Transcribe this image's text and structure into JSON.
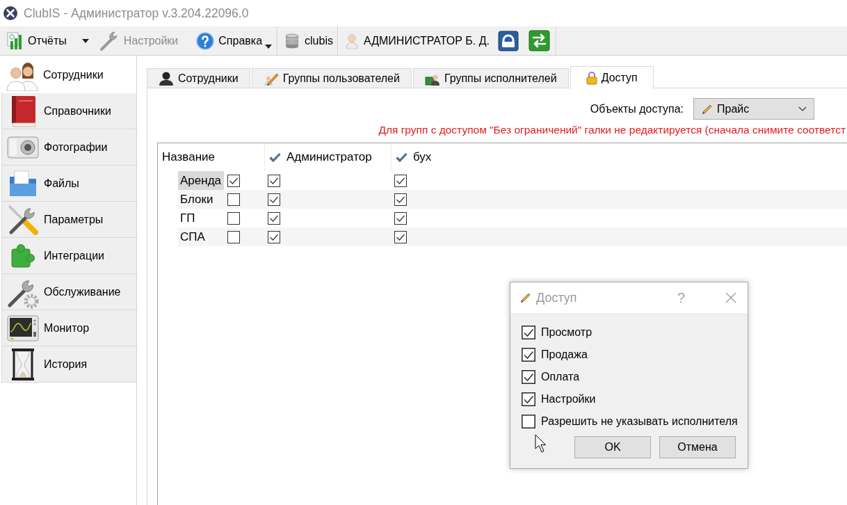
{
  "window": {
    "title": "ClubIS - Администратор v.3.204.22096.0"
  },
  "toolbar": {
    "groups": [
      {
        "items": [
          {
            "kind": "split",
            "label": "Отчёты",
            "disabled": false
          },
          {
            "kind": "button",
            "label": "Настройки",
            "disabled": true
          },
          {
            "kind": "menu",
            "label": "Справка",
            "disabled": false
          }
        ]
      },
      {
        "items": [
          {
            "kind": "label",
            "label": "clubis",
            "disabled": false
          }
        ]
      },
      {
        "items": [
          {
            "kind": "label",
            "label": "АДМИНИСТРАТОР Б. Д.",
            "disabled": false
          },
          {
            "kind": "icon_button",
            "disabled": false
          },
          {
            "kind": "icon_button",
            "disabled": false
          }
        ]
      }
    ]
  },
  "sidebar": {
    "items": [
      {
        "label": "Сотрудники",
        "selected": true
      },
      {
        "label": "Справочники",
        "selected": false
      },
      {
        "label": "Фотографии",
        "selected": false
      },
      {
        "label": "Файлы",
        "selected": false
      },
      {
        "label": "Параметры",
        "selected": false
      },
      {
        "label": "Интеграции",
        "selected": false
      },
      {
        "label": "Обслуживание",
        "selected": false
      },
      {
        "label": "Монитор",
        "selected": false
      },
      {
        "label": "История",
        "selected": false
      }
    ]
  },
  "tabs": [
    {
      "label": "Сотрудники",
      "selected": false
    },
    {
      "label": "Группы пользователей",
      "selected": false
    },
    {
      "label": "Группы исполнителей",
      "selected": false
    },
    {
      "label": "Доступ",
      "selected": true
    }
  ],
  "access": {
    "objects_label": "Объекты доступа:",
    "objects_value": "Прайс",
    "warning": "Для групп с доступом \"Без ограничений\" галки не редактируется (сначала снимите соответст"
  },
  "table": {
    "columns": [
      {
        "kind": "text",
        "label": "Название"
      },
      {
        "kind": "blank"
      },
      {
        "kind": "group",
        "label": "Администратор"
      },
      {
        "kind": "group",
        "label": "бух"
      }
    ],
    "rows": [
      {
        "name": "Аренда",
        "selected": true,
        "cells": [
          {
            "checked": true
          },
          {
            "checked": true
          },
          {
            "checked": true
          }
        ]
      },
      {
        "name": "Блоки",
        "selected": false,
        "cells": [
          {
            "checked": false
          },
          {
            "checked": true
          },
          {
            "checked": true
          }
        ]
      },
      {
        "name": "ГП",
        "selected": false,
        "cells": [
          {
            "checked": false
          },
          {
            "checked": true
          },
          {
            "checked": true
          }
        ]
      },
      {
        "name": "СПА",
        "selected": false,
        "cells": [
          {
            "checked": false
          },
          {
            "checked": true
          },
          {
            "checked": true
          }
        ]
      }
    ]
  },
  "dialog": {
    "title": "Доступ",
    "help": "?",
    "options": [
      {
        "label": "Просмотр",
        "checked": true
      },
      {
        "label": "Продажа",
        "checked": true
      },
      {
        "label": "Оплата",
        "checked": true
      },
      {
        "label": "Настройки",
        "checked": true
      },
      {
        "label": "Разрешить не указывать исполнителя",
        "checked": false
      }
    ],
    "buttons": [
      "OK",
      "Отмена"
    ]
  }
}
